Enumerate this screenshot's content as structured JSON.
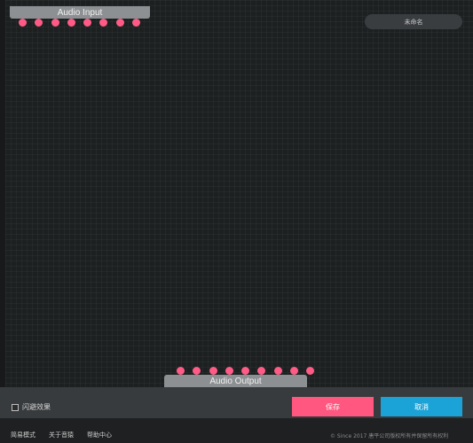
{
  "canvas": {
    "audio_input_label": "Audio Input",
    "audio_output_label": "Audio Output",
    "input_pin_count": 8,
    "output_pin_count": 9,
    "pin_color": "#ff5b86"
  },
  "name_field": {
    "value": "未命名"
  },
  "options": {
    "strobe_label": "闪避效果",
    "strobe_checked": false
  },
  "actions": {
    "save_label": "保存",
    "cancel_label": "取消",
    "save_color": "#ff577f",
    "cancel_color": "#1ba3d8"
  },
  "footer": {
    "links": [
      "简易模式",
      "关于音猿",
      "帮助中心"
    ],
    "copyright": "© Since 2017 唐平公司版权所有并保留所有权利"
  }
}
